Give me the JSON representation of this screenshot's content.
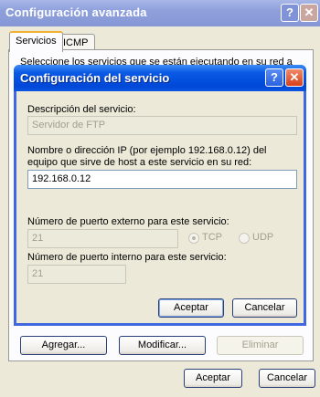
{
  "outer_window": {
    "title": "Configuración avanzada",
    "tabs": [
      {
        "label": "Servicios"
      },
      {
        "label": "ICMP"
      }
    ],
    "panel_text": "Seleccione los servicios que se están ejecutando en su red a los",
    "buttons": {
      "add": "Agregar...",
      "modify": "Modificar...",
      "delete": "Eliminar"
    },
    "ok": "Aceptar",
    "cancel": "Cancelar"
  },
  "dialog": {
    "title": "Configuración del servicio",
    "description_label": "Descripción del servicio:",
    "description_value": "Servidor de FTP",
    "host_label_line1": "Nombre o dirección IP (por ejemplo 192.168.0.12) del",
    "host_label_line2": "equipo que sirve de host a este servicio en su red:",
    "host_value": "192.168.0.12",
    "external_port_label": "Número de puerto externo para este servicio:",
    "external_port_value": "21",
    "protocol_tcp": "TCP",
    "protocol_udp": "UDP",
    "protocol_selected": "TCP",
    "internal_port_label": "Número de puerto interno para este servicio:",
    "internal_port_value": "21",
    "ok": "Aceptar",
    "cancel": "Cancelar"
  },
  "titlebar_icons": {
    "help": "help-icon",
    "close": "close-icon"
  },
  "colors": {
    "dialog_titlebar": "#0a55e0",
    "outer_titlebar": "#8ea0dc",
    "window_bg": "#ece9d8"
  }
}
